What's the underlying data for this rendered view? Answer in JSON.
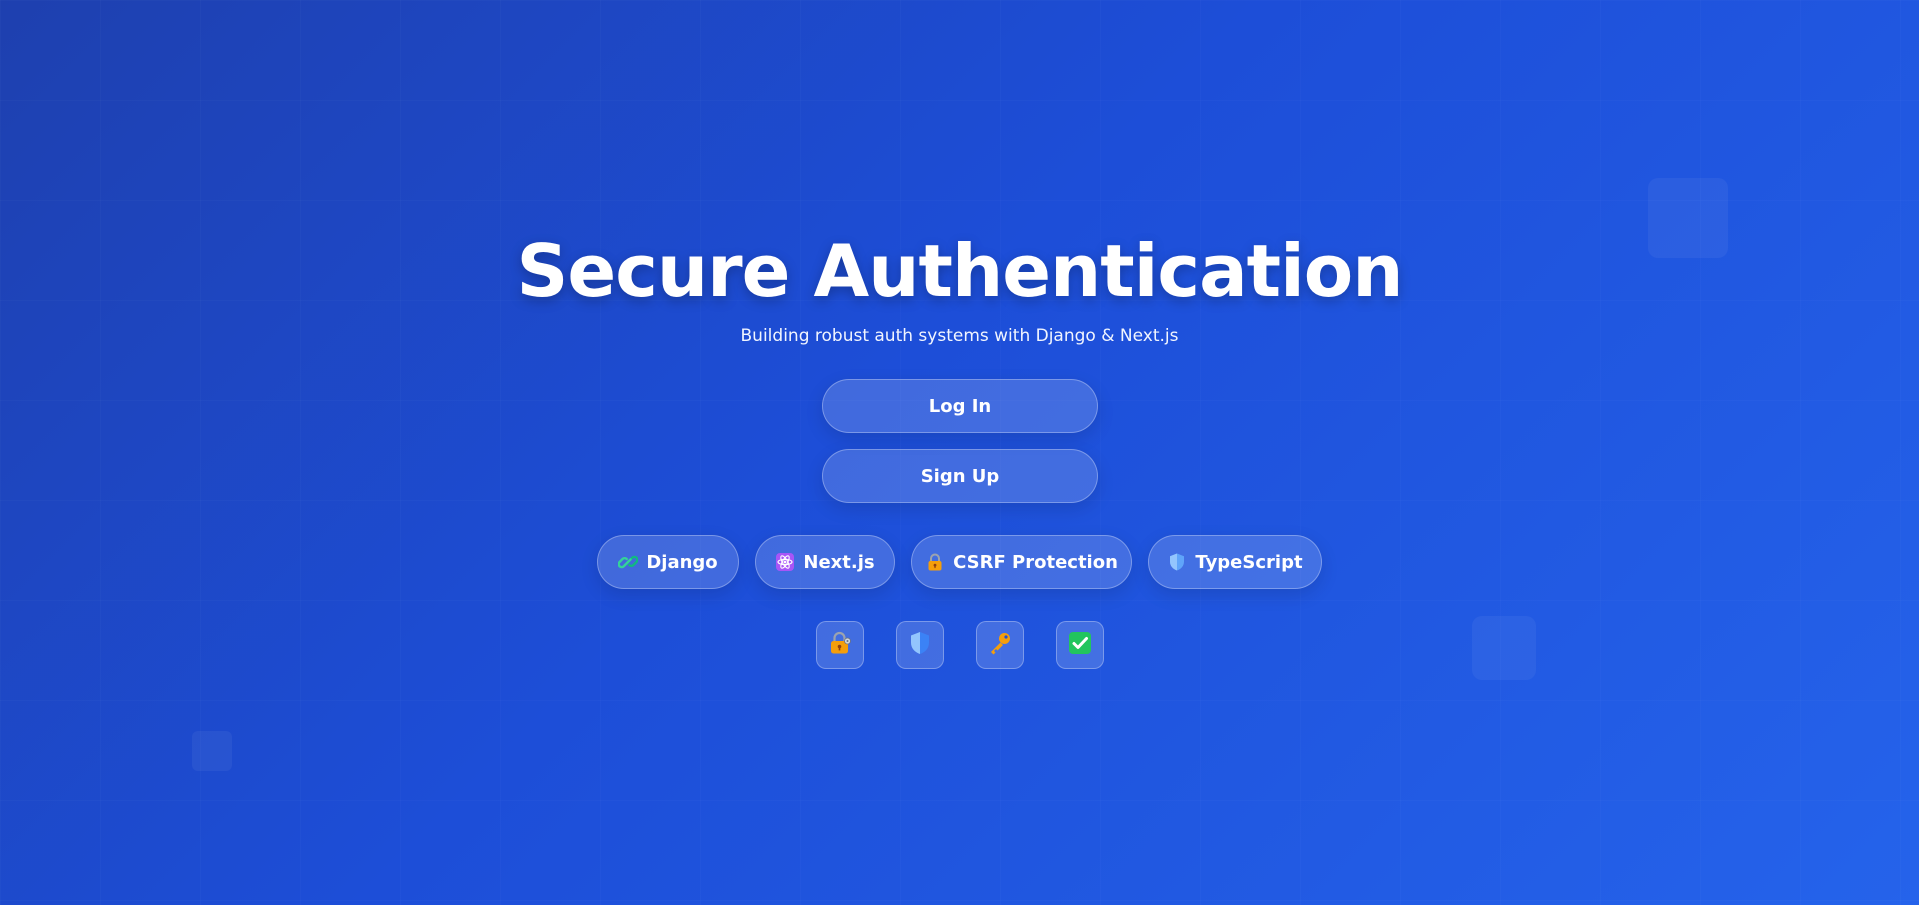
{
  "hero": {
    "title": "Secure Authentication",
    "subtitle": "Building robust auth systems with Django & Next.js"
  },
  "actions": {
    "login_label": "Log In",
    "signup_label": "Sign Up"
  },
  "tech_badges": [
    {
      "label": "Django",
      "icon": "django-link-icon",
      "color": "#34d399"
    },
    {
      "label": "Next.js",
      "icon": "atom-icon",
      "color": "#a855f7"
    },
    {
      "label": "CSRF Protection",
      "icon": "lock-icon",
      "color": "#f59e0b"
    },
    {
      "label": "TypeScript",
      "icon": "shield-icon",
      "color": "#60a5fa"
    }
  ],
  "feature_icons": [
    {
      "icon": "lock-with-key-icon"
    },
    {
      "icon": "shield-icon"
    },
    {
      "icon": "key-icon"
    },
    {
      "icon": "check-mark-icon"
    }
  ],
  "colors": {
    "background_start": "#1e40af",
    "background_end": "#2563eb",
    "text": "#ffffff"
  }
}
